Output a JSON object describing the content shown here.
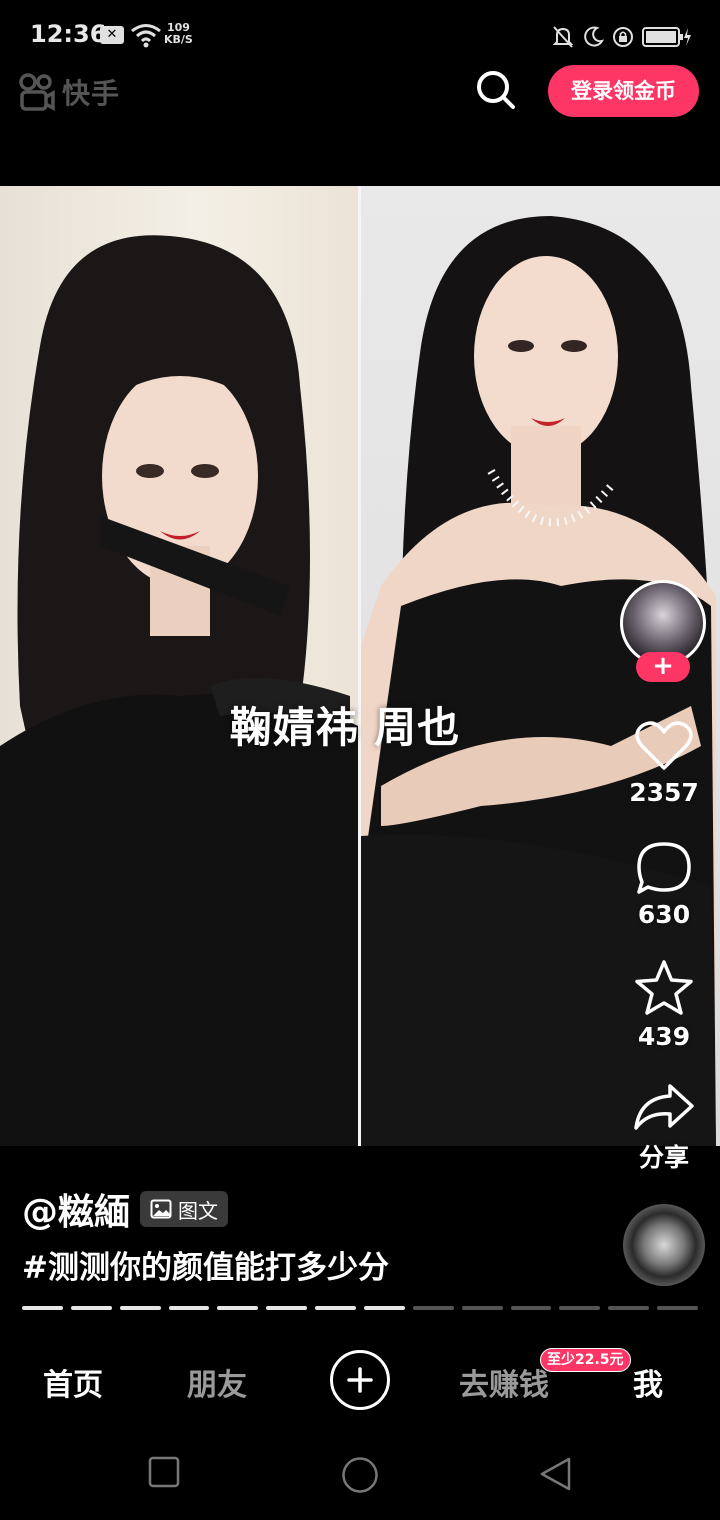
{
  "status_bar": {
    "time": "12:36",
    "notification_icon": "x-notification-icon",
    "speed_value": "109",
    "speed_unit": "KB/S",
    "icons": [
      "bell-off-icon",
      "moon-icon",
      "lock-rotation-icon",
      "battery-charging-icon"
    ]
  },
  "header": {
    "app_name": "快手",
    "search_icon": "search-icon",
    "login_label": "登录领金币"
  },
  "post": {
    "overlay_caption": "鞠婧祎 周也",
    "author": "@糍緬",
    "content_type": "图文",
    "hashtag": "#测测你的颜值能打多少分",
    "progress": {
      "total": 14,
      "current": 8
    }
  },
  "actions": {
    "follow_label": "+",
    "likes": "2357",
    "comments": "630",
    "favorites": "439",
    "share_label": "分享"
  },
  "tabbar": {
    "home": "首页",
    "friends": "朋友",
    "create_icon": "plus-icon",
    "earn": "去赚钱",
    "earn_badge": "至少22.5元",
    "me": "我"
  },
  "navbar": {
    "recent": "square-icon",
    "home": "circle-icon",
    "back": "triangle-back-icon"
  },
  "colors": {
    "accent": "#fe3666",
    "background": "#000000",
    "inactive_tab": "#9a9a9a"
  }
}
